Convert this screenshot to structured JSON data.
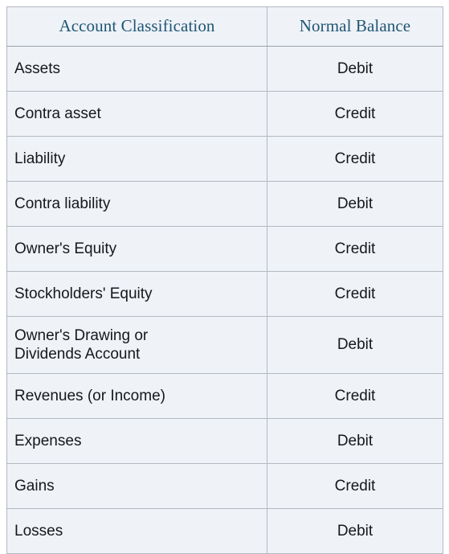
{
  "table": {
    "columns": [
      {
        "id": "classification",
        "label": "Account Classification",
        "align": "left"
      },
      {
        "id": "balance",
        "label": "Normal Balance",
        "align": "center"
      }
    ],
    "rows": [
      {
        "classification": "Assets",
        "balance": "Debit"
      },
      {
        "classification": "Contra asset",
        "balance": "Credit"
      },
      {
        "classification": "Liability",
        "balance": "Credit"
      },
      {
        "classification": "Contra liability",
        "balance": "Debit"
      },
      {
        "classification": "Owner's Equity",
        "balance": "Credit"
      },
      {
        "classification": "Stockholders' Equity",
        "balance": "Credit"
      },
      {
        "classification": "Owner's Drawing or Dividends Account",
        "classification_line1": "Owner's Drawing or",
        "classification_line2": "Dividends Account",
        "balance": "Debit",
        "tall": true
      },
      {
        "classification": "Revenues (or Income)",
        "balance": "Credit"
      },
      {
        "classification": "Expenses",
        "balance": "Debit"
      },
      {
        "classification": "Gains",
        "balance": "Credit"
      },
      {
        "classification": "Losses",
        "balance": "Debit"
      }
    ]
  },
  "colors": {
    "header_text": "#1e5674",
    "cell_background": "#eff2f7",
    "border": "#b3b9c1",
    "body_text": "#15181c",
    "page_background": "#ffffff"
  }
}
